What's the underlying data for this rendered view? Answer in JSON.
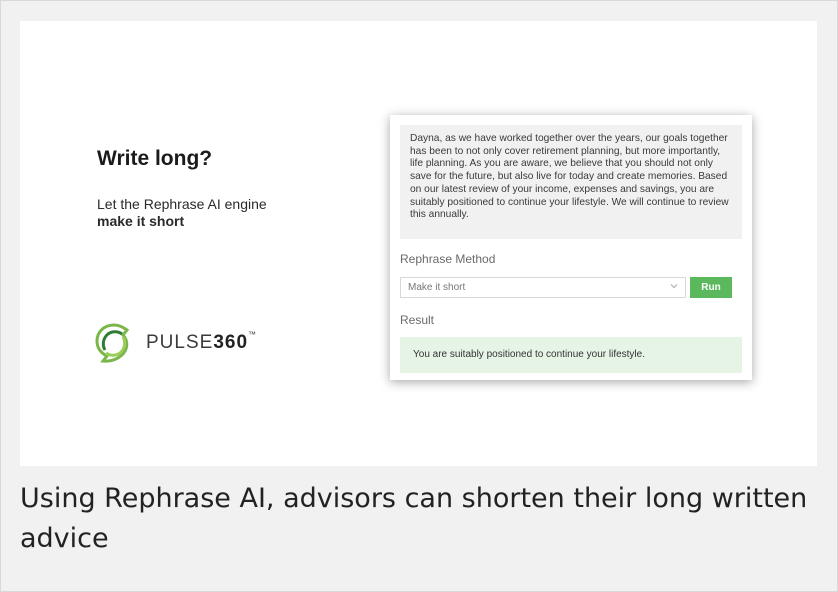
{
  "slide": {
    "headline": "Write long?",
    "subline": "Let the Rephrase AI engine",
    "subline_bold": "make it short",
    "logo": {
      "text_light": "PULSE",
      "text_bold": "360",
      "mark": "™",
      "icon": "pulse360-logo-icon"
    }
  },
  "app": {
    "source_text": "Dayna, as we have worked together over the years, our goals together has been to not only cover retirement planning, but more importantly, life planning. As you are aware, we believe that you should not only save for the future, but also live for today and create memories. Based on our latest review of your income, expenses and savings, you are suitably positioned to continue your lifestyle. We will continue to review this annually.",
    "method_label": "Rephrase Method",
    "method_value": "Make it short",
    "run_label": "Run",
    "result_label": "Result",
    "result_text": "You are suitably positioned to continue your lifestyle.",
    "colors": {
      "run_button": "#5cb85c",
      "result_bg": "#e6f4e6"
    }
  },
  "caption": "Using Rephrase AI, advisors can shorten their long written advice"
}
